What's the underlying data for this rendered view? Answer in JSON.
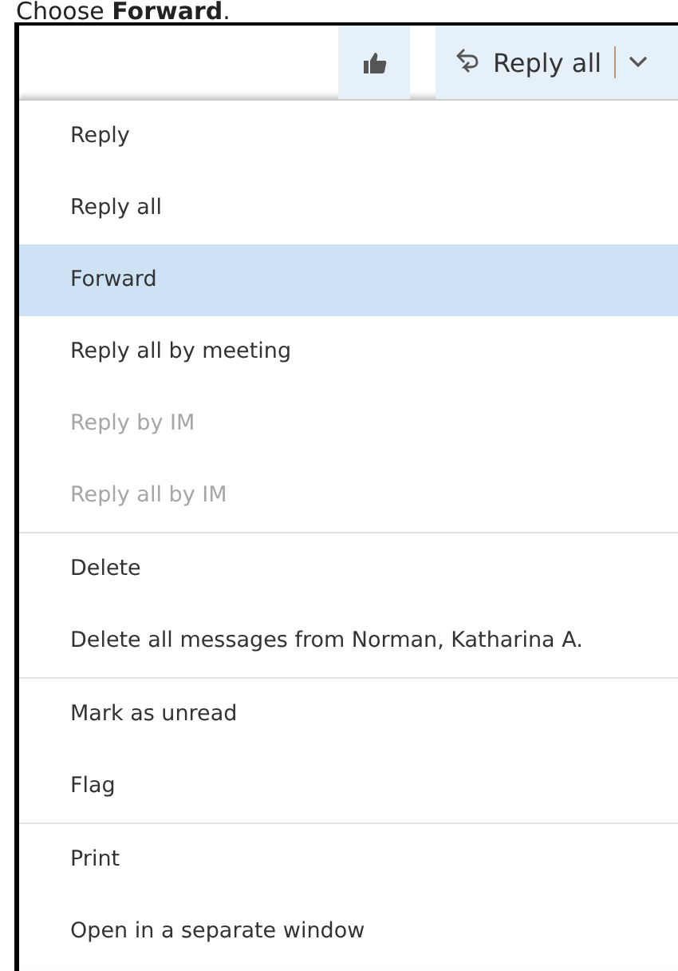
{
  "caption": "Choose **Forward**.",
  "toolbar": {
    "like_button": {
      "selected": true
    },
    "reply_all_button": {
      "label": "Reply all",
      "selected": true
    }
  },
  "menu": {
    "groups": [
      {
        "items": [
          {
            "label": "Reply",
            "disabled": false,
            "selected": false
          },
          {
            "label": "Reply all",
            "disabled": false,
            "selected": false
          },
          {
            "label": "Forward",
            "disabled": false,
            "selected": true
          },
          {
            "label": "Reply all by meeting",
            "disabled": false,
            "selected": false
          },
          {
            "label": "Reply by IM",
            "disabled": true,
            "selected": false
          },
          {
            "label": "Reply all by IM",
            "disabled": true,
            "selected": false
          }
        ]
      },
      {
        "items": [
          {
            "label": "Delete",
            "disabled": false,
            "selected": false
          },
          {
            "label": "Delete all messages from Norman, Katharina A.",
            "disabled": false,
            "selected": false
          }
        ]
      },
      {
        "items": [
          {
            "label": "Mark as unread",
            "disabled": false,
            "selected": false
          },
          {
            "label": "Flag",
            "disabled": false,
            "selected": false
          }
        ]
      },
      {
        "items": [
          {
            "label": "Print",
            "disabled": false,
            "selected": false
          },
          {
            "label": "Open in a separate window",
            "disabled": false,
            "selected": false
          }
        ]
      }
    ]
  }
}
